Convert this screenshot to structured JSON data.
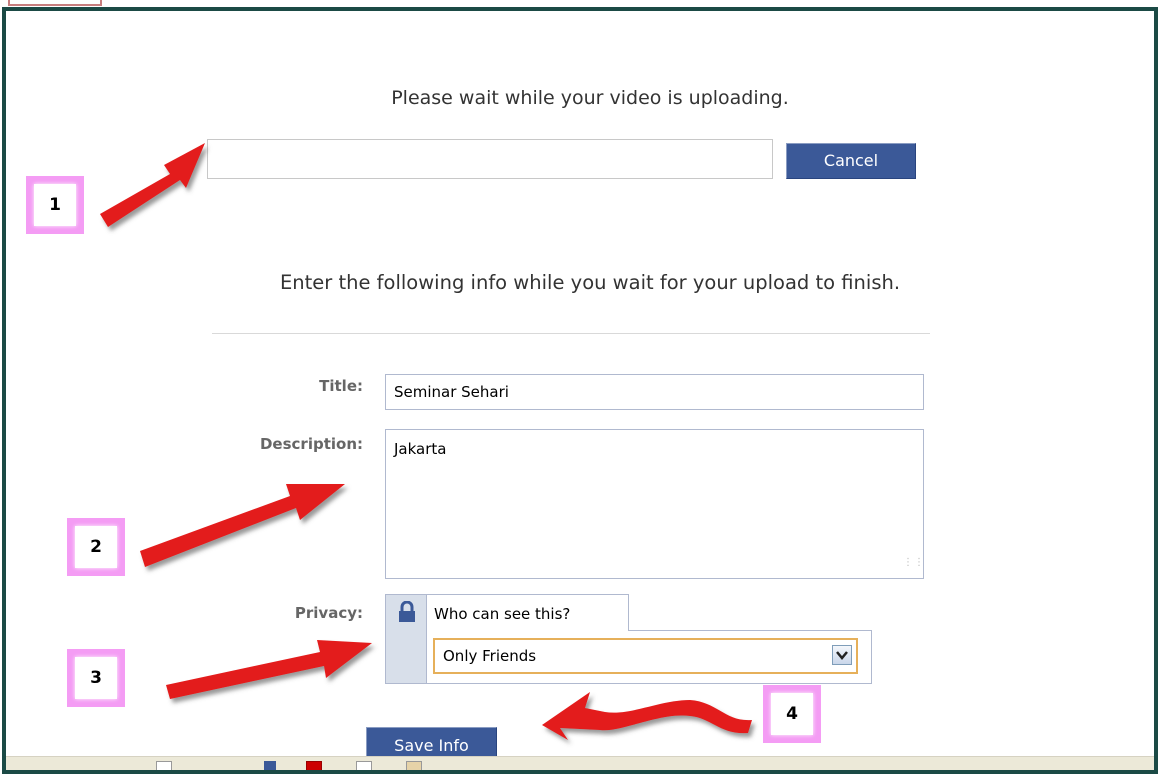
{
  "upload": {
    "heading": "Please wait while your video is uploading.",
    "progress": 0,
    "cancel_label": "Cancel"
  },
  "form": {
    "heading": "Enter the following info while you wait for your upload to finish.",
    "title_label": "Title:",
    "title_value": "Seminar Sehari",
    "description_label": "Description:",
    "description_value": "Jakarta",
    "privacy_label": "Privacy:",
    "privacy_tab_label": "Who can see this?",
    "privacy_selected": "Only Friends",
    "save_label": "Save Info"
  },
  "annotations": {
    "badges": [
      "1",
      "2",
      "3",
      "4"
    ],
    "badge_color": "#f49cf4",
    "arrow_color": "#e31b1b"
  },
  "colors": {
    "button": "#3b5998",
    "frame": "#1b4a45",
    "select_highlight": "#e6b05a"
  }
}
